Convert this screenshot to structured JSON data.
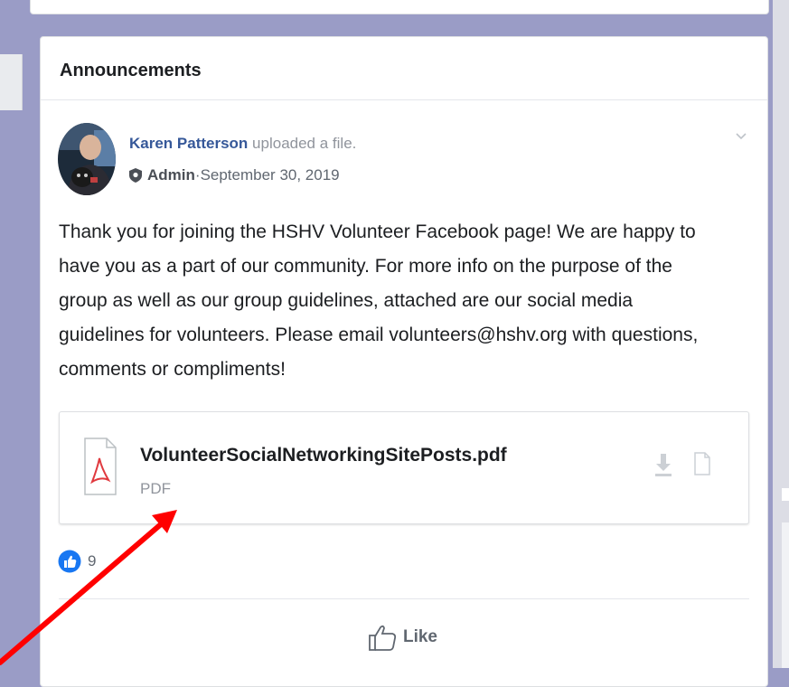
{
  "section": {
    "title": "Announcements"
  },
  "post": {
    "author_name": "Karen Patterson",
    "action_text": " uploaded a file.",
    "role": "Admin",
    "separator": " · ",
    "date": "September 30, 2019",
    "body_lines": [
      "Thank you for joining the HSHV Volunteer Facebook page! We are happy to",
      "have you as a part of our community. For more info on the purpose of the",
      "group as well as our group guidelines, attached are our social media",
      "guidelines for volunteers. Please email volunteers@hshv.org with questions,",
      "comments or compliments!"
    ]
  },
  "attachment": {
    "file_name": "VolunteerSocialNetworkingSitePosts.pdf",
    "file_type": "PDF"
  },
  "reactions": {
    "count": "9"
  },
  "actions": {
    "like_label": "Like"
  },
  "colors": {
    "background": "#9a9cc6",
    "author_link": "#365899",
    "like_blue": "#1877f2",
    "annotation_arrow": "#ff0000",
    "pdf_red": "#e0393e"
  },
  "icons": {
    "author_avatar": "avatar",
    "role_badge": "shield-icon",
    "post_menu": "chevron-down-icon",
    "file": "pdf-file-icon",
    "download": "download-icon",
    "preview": "document-icon",
    "reaction": "like-reaction-icon",
    "like_button": "thumbs-up-icon",
    "annotation": "red-arrow"
  }
}
